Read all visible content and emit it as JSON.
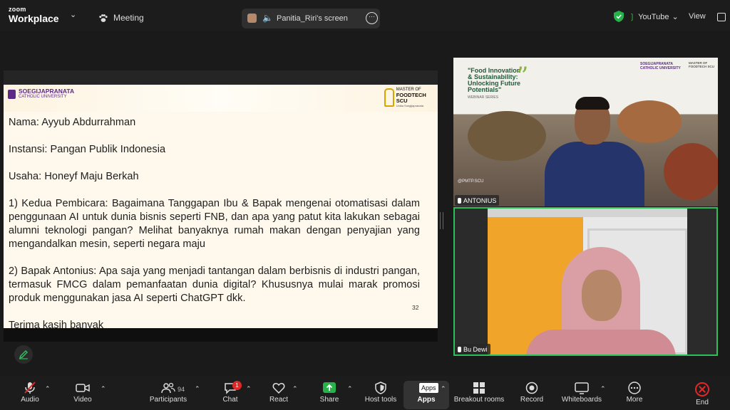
{
  "topbar": {
    "brand_small": "zoom",
    "brand_large": "Workplace",
    "meeting_label": "Meeting",
    "share_label": "Panitia_Riri's screen",
    "stream_label": "YouTube",
    "view_label": "View"
  },
  "slide": {
    "logo_left_line1": "SOEGIJAPRANATA",
    "logo_left_line2": "CATHOLIC UNIVERSITY",
    "logo_right_line1": "MASTER OF",
    "logo_right_line2": "FOODTECH SCU",
    "logo_right_line3": "Unika Soegijapranata",
    "name": "Nama: Ayyub Abdurrahman",
    "institution": "Instansi: Pangan Publik Indonesia",
    "business": "Usaha: Honeyf Maju Berkah",
    "question1": "1) Kedua Pembicara: Bagaimana Tanggapan Ibu & Bapak mengenai otomatisasi dalam penggunaan AI untuk dunia bisnis seperti FNB, dan apa yang patut kita lakukan sebagai alumni teknologi pangan? Melihat banyaknya rumah makan dengan penyajian yang mengandalkan mesin, seperti negara maju",
    "question2": "2) Bapak Antonius: Apa saja yang menjadi tantangan dalam berbisnis di industri pangan, termasuk FMCG dalam pemanfaatan dunia digital? Khususnya mulai marak promosi produk menggunakan jasa AI seperti ChatGPT dkk.",
    "thanks": "Terima kasih banyak",
    "page_number": "32"
  },
  "participants": [
    {
      "name": "ANTONIUS",
      "background_title": "\"Food Innovation & Sustainability: Unlocking Future Potentials\"",
      "background_subtitle": "WEBINAR SERIES",
      "background_logo1": "SOEGIJAPRANATA CATHOLIC UNIVERSITY",
      "background_logo2": "MASTER OF FOODTECH SCU",
      "background_handle": "@PMTP.SCU"
    },
    {
      "name": "Bu Dewi",
      "active_speaker": true
    }
  ],
  "toolbar": {
    "audio": "Audio",
    "video": "Video",
    "participants": "Participants",
    "participant_count": "94",
    "chat": "Chat",
    "chat_badge": "1",
    "react": "React",
    "share": "Share",
    "host_tools": "Host tools",
    "apps": "Apps",
    "apps_tooltip": "Apps",
    "breakout_rooms": "Breakout rooms",
    "record": "Record",
    "whiteboards": "Whiteboards",
    "more": "More",
    "end": "End"
  },
  "colors": {
    "active_speaker_border": "#2ebe5a",
    "share_green": "#26b14a",
    "end_red": "#e02828",
    "slide_bg": "#fef9ec"
  }
}
